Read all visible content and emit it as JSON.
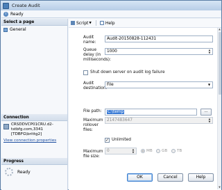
{
  "window": {
    "title": "Create Audit"
  },
  "status": {
    "icon": "info-icon",
    "text": "Ready"
  },
  "sidebar": {
    "select_page_header": "Select a page",
    "pages": [
      {
        "label": "General",
        "icon": "page-icon"
      }
    ],
    "connection_header": "Connection",
    "server_text": "CRSDDVCP01CRU.d2-tstbfg.com,3341 [TDBFG\\brittg2]",
    "view_connection_link": "View connection properties",
    "progress_header": "Progress",
    "progress_status": "Ready"
  },
  "toolbar": {
    "script_label": "Script",
    "help_label": "Help"
  },
  "form": {
    "audit_name_label": "Audit name:",
    "audit_name_value": "Audit-20150828-112431",
    "queue_delay_label": "Queue delay (in milliseconds):",
    "queue_delay_value": "1000",
    "shutdown_label": "Shut down server on audit log failure",
    "shutdown_checked": false,
    "destination_label": "Audit destination:",
    "destination_value": "File",
    "file_path_label": "File path:",
    "file_path_value": "C:\\temp",
    "browse_label": "...",
    "max_rollover_label": "Maximum rollover files:",
    "max_rollover_value": "2147483647",
    "unlimited_label": "Unlimited",
    "unlimited_checked": true,
    "max_file_size_label": "Maximum file size:",
    "max_file_size_value": "0",
    "unit_mb": "MB",
    "unit_gb": "GB",
    "unit_tb": "TB"
  },
  "buttons": {
    "ok": "OK",
    "cancel": "Cancel",
    "help": "Help"
  }
}
